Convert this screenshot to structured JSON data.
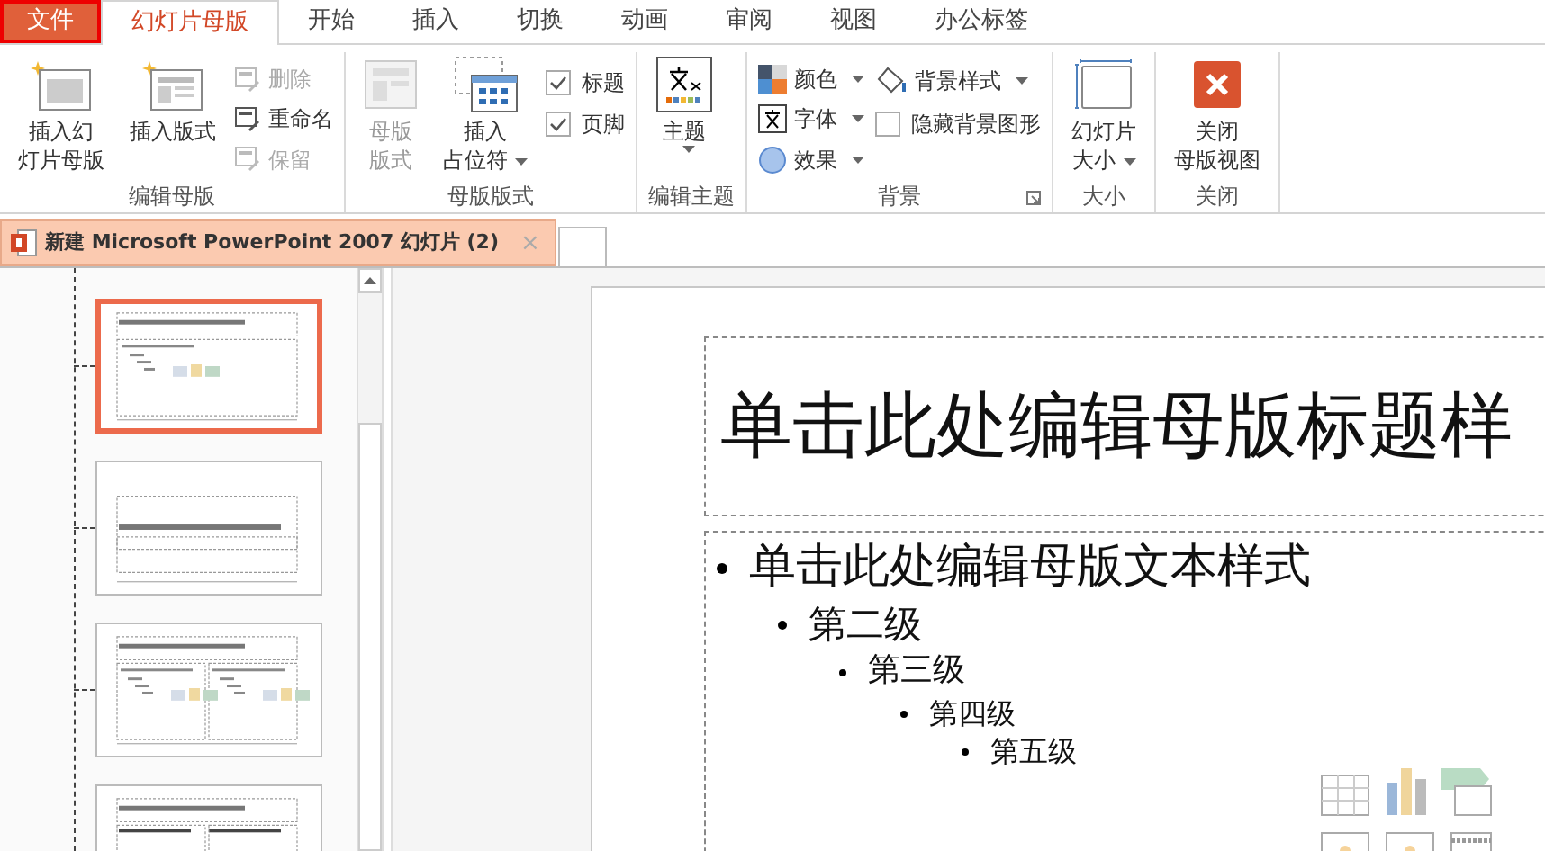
{
  "menu_tabs": [
    {
      "label": "文件",
      "selected": false,
      "kind": "file"
    },
    {
      "label": "幻灯片母版",
      "selected": true,
      "kind": "tab"
    },
    {
      "label": "开始",
      "selected": false,
      "kind": "tab"
    },
    {
      "label": "插入",
      "selected": false,
      "kind": "tab"
    },
    {
      "label": "切换",
      "selected": false,
      "kind": "tab"
    },
    {
      "label": "动画",
      "selected": false,
      "kind": "tab"
    },
    {
      "label": "审阅",
      "selected": false,
      "kind": "tab"
    },
    {
      "label": "视图",
      "selected": false,
      "kind": "tab"
    },
    {
      "label": "办公标签",
      "selected": false,
      "kind": "tab"
    }
  ],
  "ribbon": {
    "groups": [
      {
        "title": "编辑母版",
        "items": [
          {
            "kind": "large",
            "label_lines": [
              "插入幻",
              "灯片母版"
            ],
            "disabled": false,
            "menu": false
          },
          {
            "kind": "large",
            "label_lines": [
              "插入版式"
            ],
            "disabled": false,
            "menu": false
          },
          {
            "kind": "small",
            "label": "删除",
            "disabled": true,
            "menu": false
          },
          {
            "kind": "small",
            "label": "重命名",
            "disabled": false,
            "menu": false
          },
          {
            "kind": "small",
            "label": "保留",
            "disabled": true,
            "menu": false
          }
        ]
      },
      {
        "title": "母版版式",
        "items": [
          {
            "kind": "large",
            "label_lines": [
              "母版",
              "版式"
            ],
            "disabled": true,
            "menu": false
          },
          {
            "kind": "large",
            "label_lines": [
              "插入",
              "占位符"
            ],
            "disabled": false,
            "menu": true
          },
          {
            "kind": "checkbox",
            "label": "标题",
            "checked": true
          },
          {
            "kind": "checkbox",
            "label": "页脚",
            "checked": true
          }
        ]
      },
      {
        "title": "编辑主题",
        "items": [
          {
            "kind": "large",
            "label_lines": [
              "主题"
            ],
            "disabled": false,
            "menu": true
          }
        ]
      },
      {
        "title": "背景",
        "launcher": true,
        "items": [
          {
            "kind": "small",
            "label": "颜色",
            "disabled": false,
            "menu": true
          },
          {
            "kind": "small",
            "label": "字体",
            "disabled": false,
            "menu": true
          },
          {
            "kind": "small",
            "label": "效果",
            "disabled": false,
            "menu": true
          },
          {
            "kind": "small",
            "label": "背景样式",
            "disabled": false,
            "menu": true
          },
          {
            "kind": "checkbox",
            "label": "隐藏背景图形",
            "checked": false
          }
        ]
      },
      {
        "title": "大小",
        "items": [
          {
            "kind": "large",
            "label_lines": [
              "幻灯片",
              "大小"
            ],
            "disabled": false,
            "menu": true
          }
        ]
      },
      {
        "title": "关闭",
        "items": [
          {
            "kind": "large",
            "label_lines": [
              "关闭",
              "母版视图"
            ],
            "disabled": false,
            "menu": false
          }
        ]
      }
    ]
  },
  "document_tab": {
    "title": "新建 Microsoft PowerPoint 2007 幻灯片 (2)",
    "close": "×"
  },
  "thumbnails": [
    {
      "selected": true
    },
    {
      "selected": false
    },
    {
      "selected": false
    },
    {
      "selected": false
    }
  ],
  "slide": {
    "title": "单击此处编辑母版标题样",
    "body": [
      {
        "text": "单击此处编辑母版文本样式",
        "children": [
          {
            "text": "第二级",
            "children": [
              {
                "text": "第三级",
                "children": [
                  {
                    "text": "第四级",
                    "children": [
                      {
                        "text": "第五级"
                      }
                    ]
                  }
                ]
              }
            ]
          }
        ]
      }
    ]
  }
}
